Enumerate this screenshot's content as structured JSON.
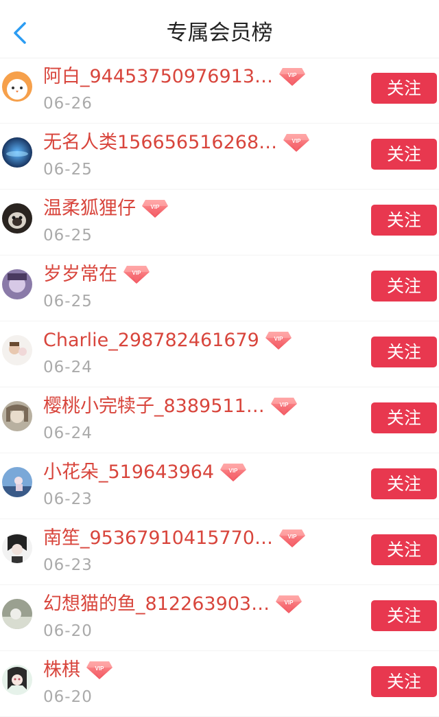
{
  "header": {
    "title": "专属会员榜",
    "back_icon": "chevron-left-icon",
    "accent_color": "#2b9cf2"
  },
  "colors": {
    "name": "#d8453c",
    "date": "#aaaaaa",
    "follow_bg": "#e8384f",
    "follow_text": "#ffffff"
  },
  "vip_badge_text": "VIP",
  "members": [
    {
      "name": "阿白_94453750976913…",
      "date": "06-26",
      "follow_label": "关注"
    },
    {
      "name": "无名人类156656516268…",
      "date": "06-25",
      "follow_label": "关注"
    },
    {
      "name": "温柔狐狸仔",
      "date": "06-25",
      "follow_label": "关注"
    },
    {
      "name": "岁岁常在",
      "date": "06-25",
      "follow_label": "关注"
    },
    {
      "name": "Charlie_298782461679",
      "date": "06-24",
      "follow_label": "关注"
    },
    {
      "name": "樱桃小完犊子_8389511…",
      "date": "06-24",
      "follow_label": "关注"
    },
    {
      "name": "小花朵_519643964",
      "date": "06-23",
      "follow_label": "关注"
    },
    {
      "name": "南笙_95367910415770…",
      "date": "06-23",
      "follow_label": "关注"
    },
    {
      "name": "幻想猫的鱼_812263903…",
      "date": "06-20",
      "follow_label": "关注"
    },
    {
      "name": "株棋",
      "date": "06-20",
      "follow_label": "关注"
    }
  ]
}
